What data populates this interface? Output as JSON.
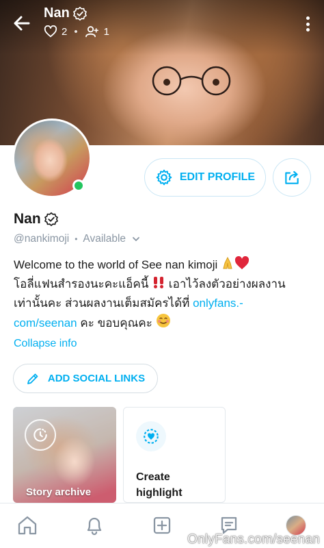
{
  "header": {
    "name": "Nan",
    "likes": "2",
    "fans": "1"
  },
  "profile": {
    "name": "Nan",
    "handle": "@nankimoji",
    "status": "Available",
    "edit_label": "EDIT PROFILE",
    "bio_line1": "Welcome to the world of See nan kimoji ",
    "bio_line2": "โอลี่แฟนสำรองนะคะแอ็คนี้ ",
    "bio_line2b": " เอาไว้ลงตัวอย่างผลงาน",
    "bio_line3": "เท่านั้นคะ ส่วนผลงานเต็มสมัครได้ที่ ",
    "bio_link": "onlyfans.-\ncom/seenan",
    "bio_end": " คะ ขอบคุณคะ ",
    "collapse_label": "Collapse info",
    "social_label": "ADD SOCIAL LINKS"
  },
  "highlights": {
    "story_label": "Story archive",
    "create_label": "Create highlight"
  },
  "watermark": "OnlyFans.com/seenan",
  "colors": {
    "accent": "#00aff0",
    "muted": "#8a96a3",
    "online": "#22c55e"
  }
}
